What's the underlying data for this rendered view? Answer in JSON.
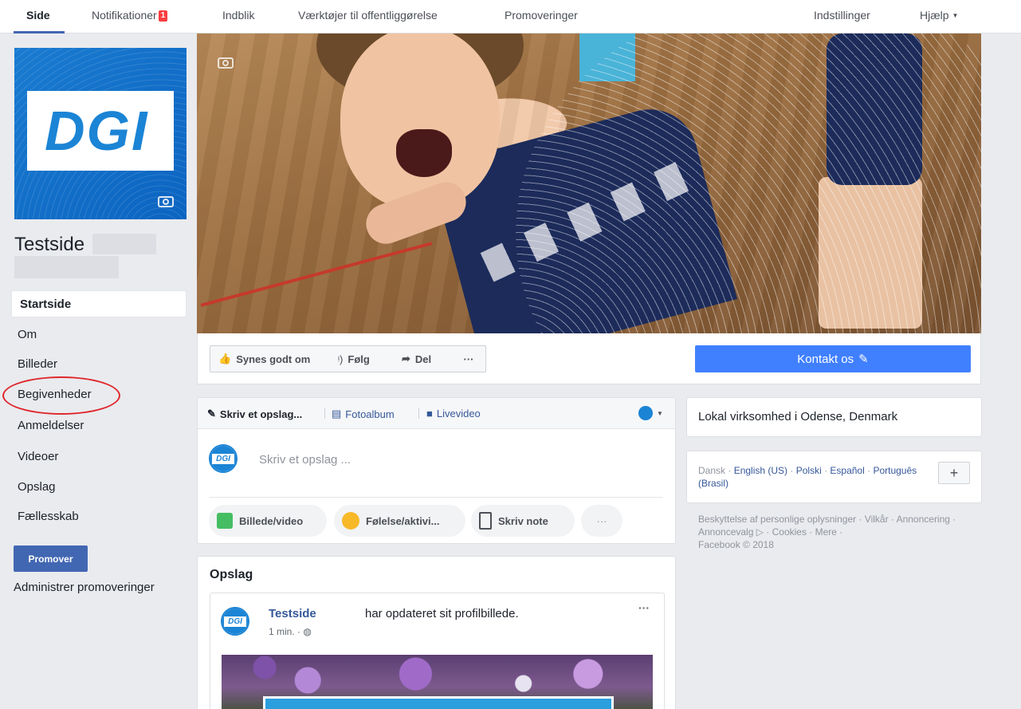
{
  "nav": {
    "items": [
      {
        "label": "Side"
      },
      {
        "label": "Notifikationer",
        "badge": "1"
      },
      {
        "label": "Indblik"
      },
      {
        "label": "Værktøjer til offentliggørelse"
      },
      {
        "label": "Promoveringer"
      }
    ],
    "settings": "Indstillinger",
    "help": "Hjælp",
    "active": "Side"
  },
  "sidebar": {
    "logo_text": "DGI",
    "page_name": "Testside",
    "items": [
      {
        "label": "Startside",
        "active": true
      },
      {
        "label": "Om"
      },
      {
        "label": "Billeder"
      },
      {
        "label": "Begivenheder",
        "highlighted": true
      },
      {
        "label": "Anmeldelser"
      },
      {
        "label": "Videoer"
      },
      {
        "label": "Opslag"
      },
      {
        "label": "Fællesskab"
      }
    ],
    "promote_button": "Promover",
    "manage_promotions": "Administrer promoveringer"
  },
  "actions": {
    "like": "Synes godt om",
    "follow": "Følg",
    "share": "Del",
    "more": "···",
    "contact": "Kontakt os"
  },
  "composer": {
    "tabs": [
      "Skriv et opslag...",
      "Fotoalbum",
      "Livevideo"
    ],
    "placeholder": "Skriv et opslag ...",
    "buttons": [
      "Billede/video",
      "Følelse/aktivi...",
      "Skriv note"
    ],
    "more": "···"
  },
  "feed": {
    "title": "Opslag",
    "post": {
      "author": "Testside",
      "action": "har opdateret sit profilbillede.",
      "time": "1 min. · ",
      "more": "···"
    }
  },
  "right": {
    "business": "Lokal virksomhed i Odense, Denmark",
    "languages": {
      "current": "Dansk",
      "others": [
        "English (US)",
        "Polski",
        "Español",
        "Português (Brasil)"
      ],
      "add": "+"
    },
    "footer": "Beskyttelse af personlige oplysninger · Vilkår · Annoncering · Annoncevalg ▷ · Cookies · Mere ·",
    "copyright": "Facebook © 2018"
  },
  "colors": {
    "brand_blue": "#4267b2",
    "contact_blue": "#4080ff",
    "badge_red": "#fa3e3e",
    "highlight_circle": "#e0262c",
    "page_bg": "#e9ebee"
  }
}
